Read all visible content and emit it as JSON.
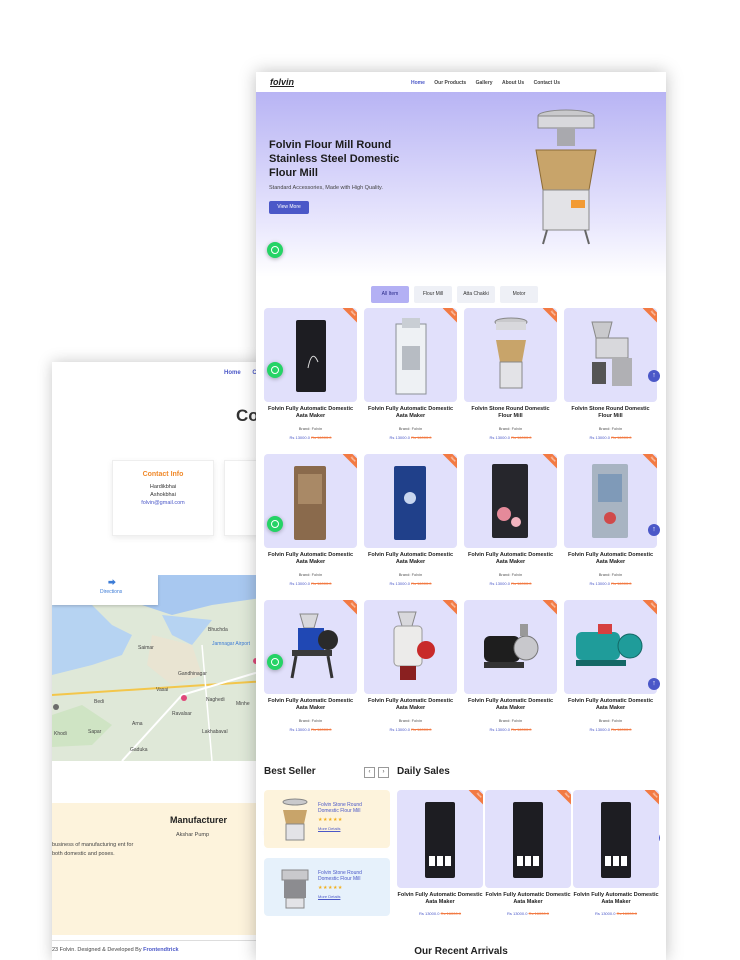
{
  "back_page": {
    "nav": [
      "Home",
      "C"
    ],
    "heading": "Co",
    "contact_card": {
      "title": "Contact Info",
      "lines": [
        "Hardikbhai",
        "Ashokbhai"
      ],
      "email": "folvin@gmail.com"
    },
    "map": {
      "directions_label": "Directions",
      "places": [
        "Bhuchda",
        "Saimar",
        "Jamnagar Airport",
        "Gandhinagar",
        "Vasai",
        "Naghedi",
        "Ravalsar",
        "Bedi",
        "Sapar",
        "Arna",
        "Lakhabaval",
        "Gaduka",
        "Khodi",
        "Minhe"
      ]
    },
    "manufacturer": {
      "title": "Manufacturer",
      "subtitle": "Akshar Pump",
      "para": "business of manufacturing ent for both domestic and poses."
    },
    "footer": {
      "text": "23 Folvin. Designed & Developed By",
      "brand": "Frontendtrick"
    }
  },
  "front_page": {
    "logo": "folvin",
    "menu": [
      "Home",
      "Our Products",
      "Gallery",
      "About Us",
      "Contact Us"
    ],
    "hero": {
      "title": "Folvin Flour Mill Round Stainless Steel Domestic Flour Mill",
      "subtitle": "Standard Accessories, Made with High Quality.",
      "button": "View More"
    },
    "filters": [
      "All Item",
      "Flour Mill",
      "Atta Chakki",
      "Motor"
    ],
    "ribbon": "New",
    "brand_label": "Brand: Folvin",
    "price_now": "Rs 13000.0",
    "price_old": "Rs 16000.0",
    "products": [
      {
        "name": "Folvin Fully Automatic Domestic Aata Maker",
        "icon": "black-atta-chakki-icon"
      },
      {
        "name": "Folvin Fully Automatic Domestic Aata Maker",
        "icon": "white-atta-chakki-icon"
      },
      {
        "name": "Folvin Stone Round Domestic Flour Mill",
        "icon": "round-flour-mill-icon"
      },
      {
        "name": "Folvin Stone Round Domestic Flour Mill",
        "icon": "pulverizer-icon"
      },
      {
        "name": "Folvin Fully Automatic Domestic Aata Maker",
        "icon": "wood-atta-chakki-icon"
      },
      {
        "name": "Folvin Fully Automatic Domestic Aata Maker",
        "icon": "blue-atta-chakki-icon"
      },
      {
        "name": "Folvin Fully Automatic Domestic Aata Maker",
        "icon": "floral-atta-chakki-icon"
      },
      {
        "name": "Folvin Fully Automatic Domestic Aata Maker",
        "icon": "silver-atta-chakki-icon"
      },
      {
        "name": "Folvin Fully Automatic Domestic Aata Maker",
        "icon": "blue-grinder-icon"
      },
      {
        "name": "Folvin Fully Automatic Domestic Aata Maker",
        "icon": "red-grinder-icon"
      },
      {
        "name": "Folvin Fully Automatic Domestic Aata Maker",
        "icon": "monoblock-pump-icon"
      },
      {
        "name": "Folvin Fully Automatic Domestic Aata Maker",
        "icon": "teal-motor-icon"
      }
    ],
    "best_seller": {
      "title": "Best Seller",
      "items": [
        {
          "name": "Folvin Stone Round Domestic Flour Mill",
          "stars": "★★★★★",
          "more": "More Details"
        },
        {
          "name": "Folvin Stone Round Domestic Flour Mill",
          "stars": "★★★★★",
          "more": "More Details"
        }
      ]
    },
    "daily_sales": {
      "title": "Daily Sales",
      "items": [
        {
          "name": "Folvin Fully Automatic Domestic Aata Maker"
        },
        {
          "name": "Folvin Fully Automatic Domestic Aata Maker"
        },
        {
          "name": "Folvin Fully Automatic Domestic Aata Maker"
        }
      ]
    },
    "recent_title": "Our Recent Arrivals"
  },
  "colors": {
    "accent": "#4b58c8",
    "ribbon": "#f27a43",
    "whatsapp": "#25d366",
    "hero_start": "#b8b4f4",
    "card_bg": "#e1e0fb"
  }
}
